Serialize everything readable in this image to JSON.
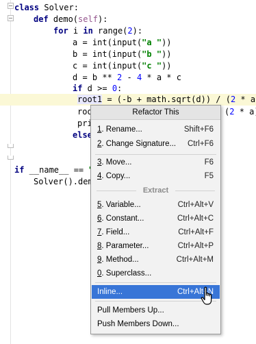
{
  "code": {
    "l1": {
      "kw": "class",
      "rest": " Solver:"
    },
    "l2": {
      "kw": "def",
      "name": " demo(",
      "self": "self",
      "rest": "):"
    },
    "l3": {
      "kw": "for",
      "rest1": " i ",
      "kw2": "in",
      "rest2": " range(",
      "num": "2",
      "rest3": "):"
    },
    "l4": {
      "pre": "a = int(input(",
      "str": "\"a \"",
      "post": "))"
    },
    "l5": {
      "pre": "b = int(input(",
      "str": "\"b \"",
      "post": "))"
    },
    "l6": {
      "pre": "c = int(input(",
      "str": "\"c \"",
      "post": "))"
    },
    "l7": {
      "pre": "d = b ** ",
      "n1": "2",
      "mid": " - ",
      "n2": "4",
      "post": " * a * c"
    },
    "l8": {
      "kw": "if",
      "rest": " d >= ",
      "num": "0",
      "end": ":"
    },
    "l9": {
      "word": "root1",
      "rest": " = (-b + math.sqrt(d)) / (",
      "num": "2",
      "post": " * a)"
    },
    "l10": {
      "pre": "roo",
      "post": "(",
      "num": "2",
      "end": " * a)"
    },
    "l11": {
      "pre": "pri"
    },
    "l12": {
      "kw": "else"
    },
    "l13": {
      "kw": "if",
      "rest": " __name__ == ",
      "str": "\""
    },
    "l14": {
      "pre": "Solver().dem"
    }
  },
  "menu": {
    "title": "Refactor This",
    "items": [
      {
        "mn": "1",
        "label": ". Rename...",
        "shortcut": "Shift+F6"
      },
      {
        "mn": "2",
        "label": ". Change Signature...",
        "shortcut": "Ctrl+F6"
      },
      {
        "mn": "3",
        "label": ". Move...",
        "shortcut": "F6"
      },
      {
        "mn": "4",
        "label": ". Copy...",
        "shortcut": "F5"
      },
      {
        "mn": "5",
        "label": ". Variable...",
        "shortcut": "Ctrl+Alt+V"
      },
      {
        "mn": "6",
        "label": ". Constant...",
        "shortcut": "Ctrl+Alt+C"
      },
      {
        "mn": "7",
        "label": ". Field...",
        "shortcut": "Ctrl+Alt+F"
      },
      {
        "mn": "8",
        "label": ". Parameter...",
        "shortcut": "Ctrl+Alt+P"
      },
      {
        "mn": "9",
        "label": ". Method...",
        "shortcut": "Ctrl+Alt+M"
      },
      {
        "mn": "0",
        "label": ". Superclass...",
        "shortcut": ""
      },
      {
        "label": "Inline...",
        "shortcut": "Ctrl+Alt+N"
      },
      {
        "label": "Pull Members Up...",
        "shortcut": ""
      },
      {
        "label": "Push Members Down...",
        "shortcut": ""
      }
    ],
    "group_extract": "Extract"
  },
  "colors": {
    "selection": "#3875d7",
    "current_line": "#fbf8d6",
    "keyword": "#000080",
    "string": "#008000"
  }
}
